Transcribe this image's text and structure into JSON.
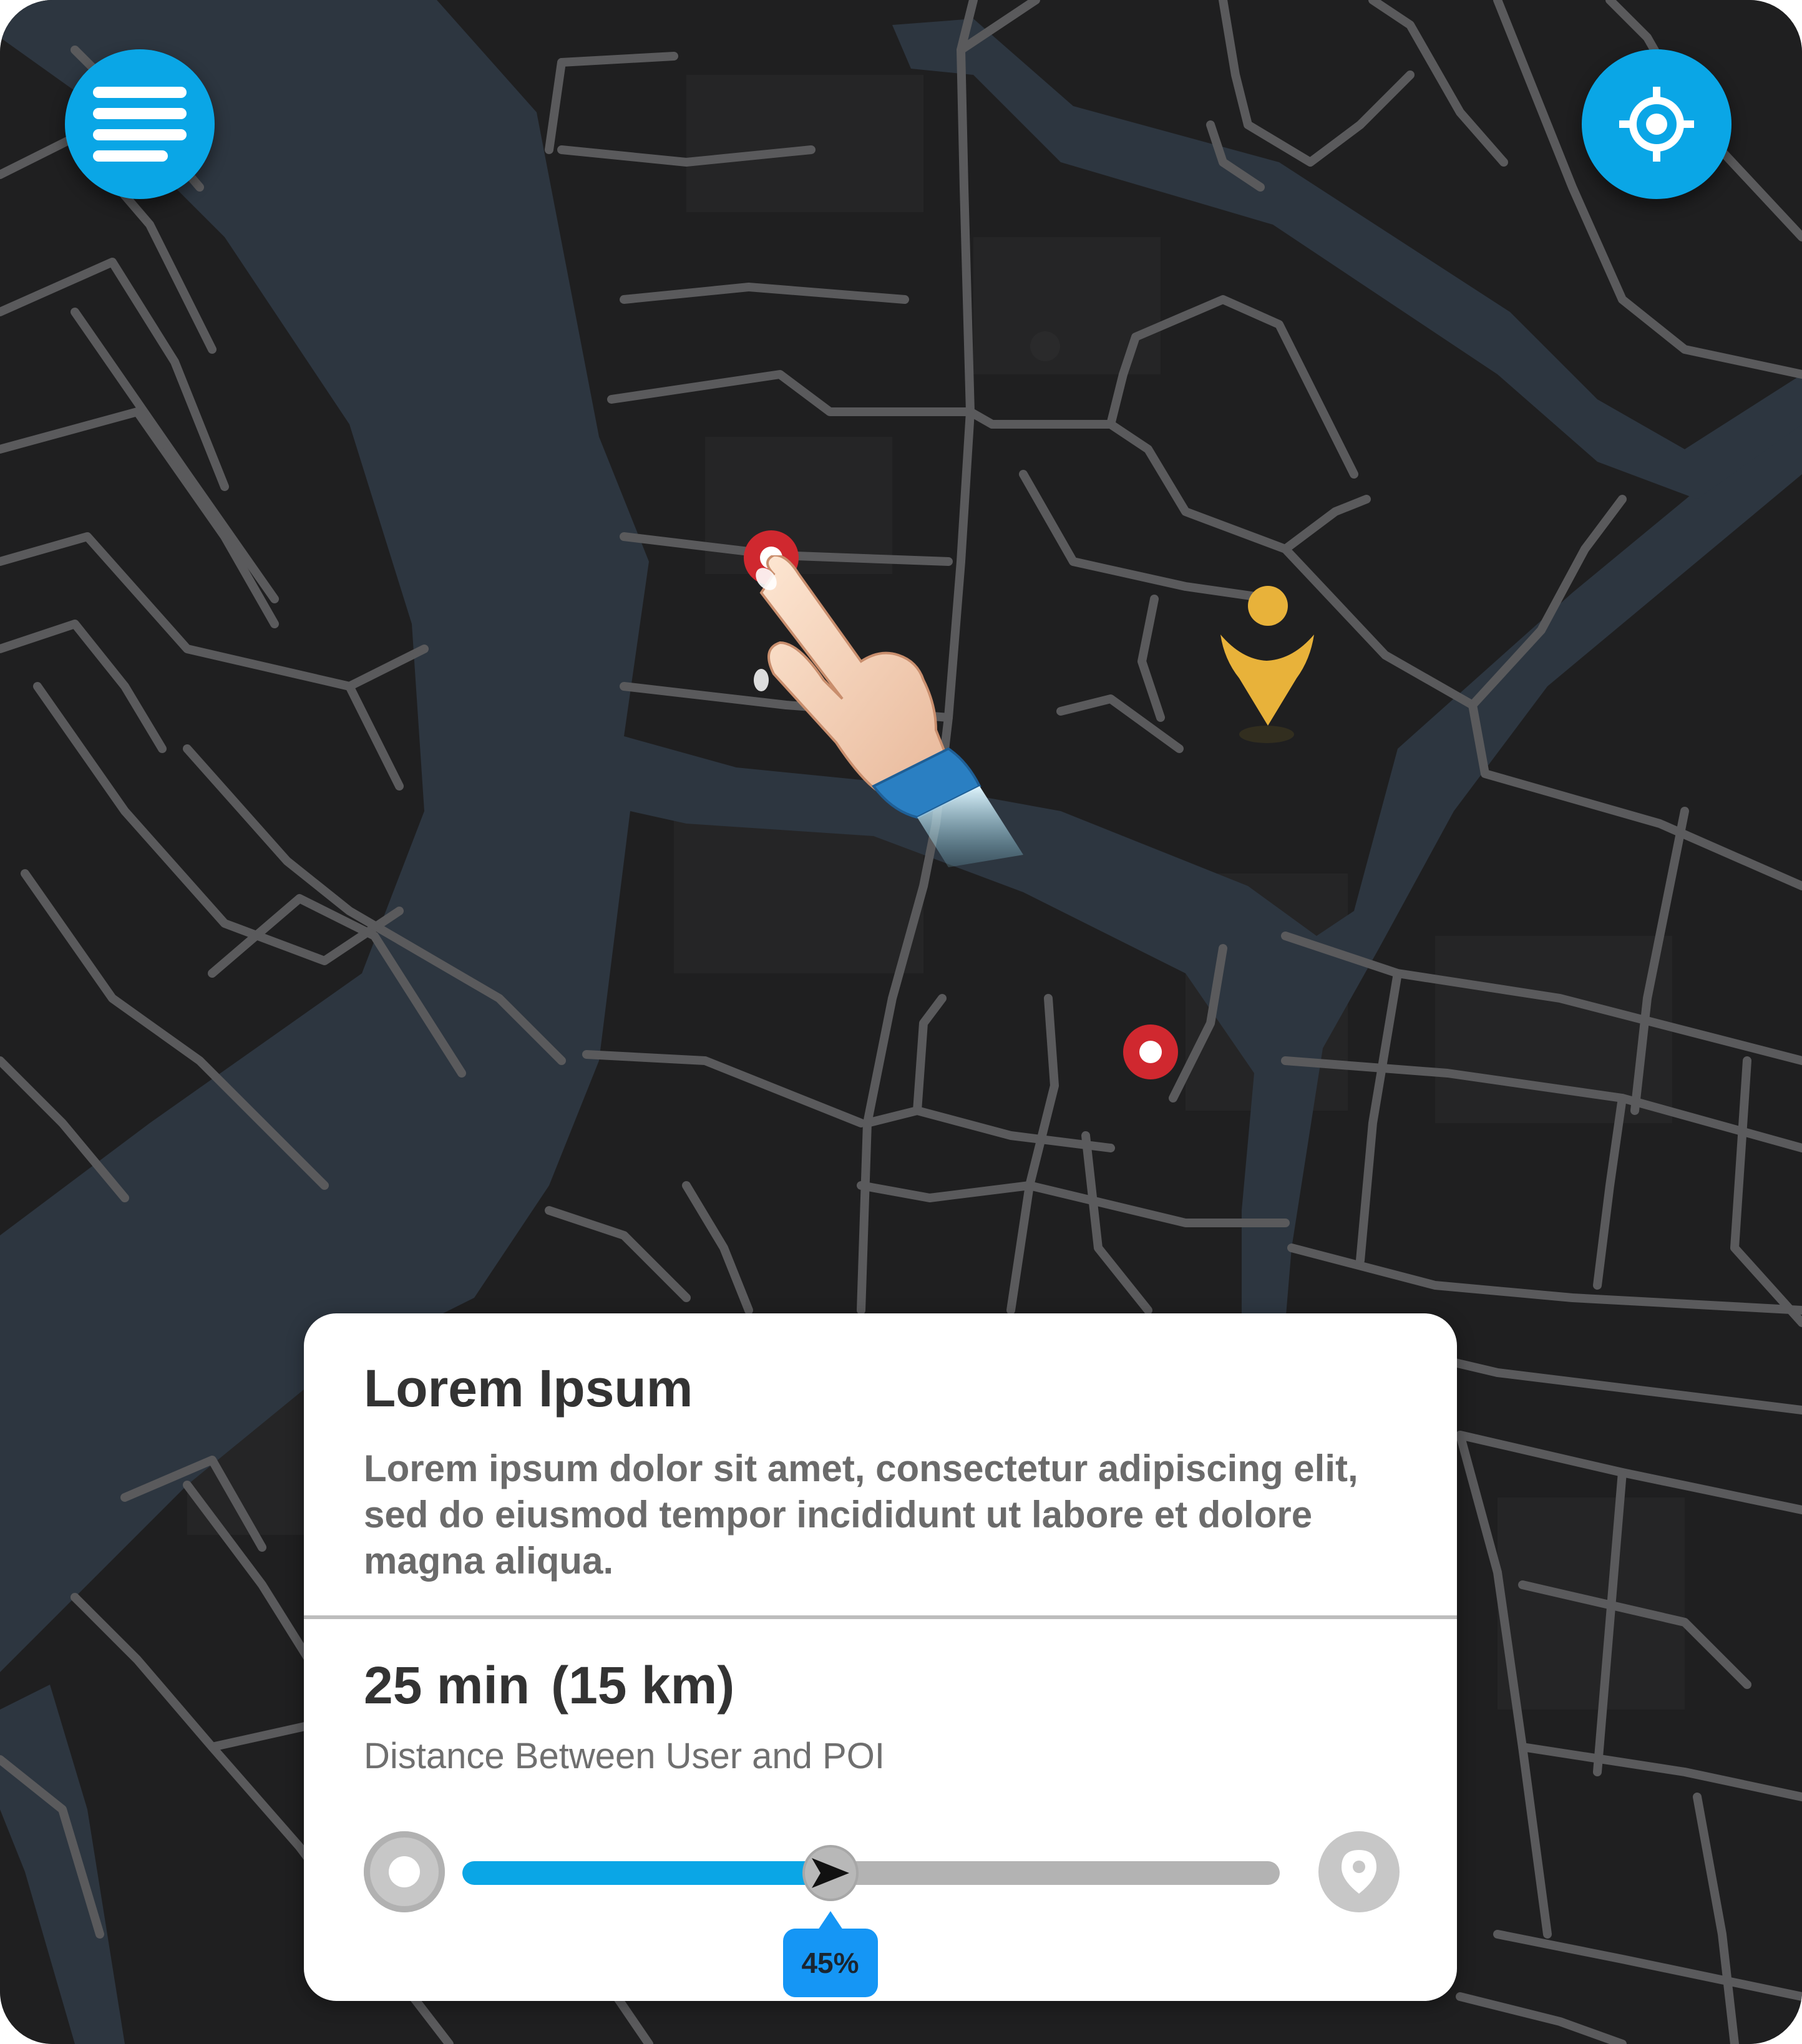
{
  "map": {
    "water_color": "#2d3640",
    "land_color": "#1f1f20",
    "road_color": "#5a5a5c"
  },
  "controls": {
    "menu_icon": "menu-lines-icon",
    "locate_icon": "crosshair-icon",
    "accent_color": "#0aa6e6"
  },
  "markers": {
    "poi_color": "#d0282f",
    "user_color": "#e8b23a"
  },
  "card": {
    "title": "Lorem Ipsum",
    "description": "Lorem ipsum dolor sit amet, consectetur adipiscing elit, sed do eiusmod tempor incididunt ut labore et dolore magna aliqua.",
    "duration": "25 min",
    "distance": "(15 km)",
    "distance_label": "Distance Between User and POI",
    "progress_percent": 45,
    "progress_text": "45%"
  }
}
